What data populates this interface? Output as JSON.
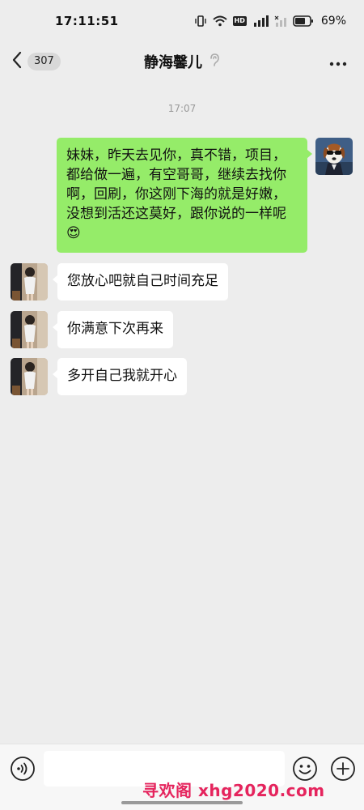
{
  "status_bar": {
    "time": "17:11:51",
    "battery_percent": "69%",
    "hd_label": "HD",
    "icons": [
      "vibrate-icon",
      "wifi-icon",
      "hd-icon",
      "signal-5g-icon",
      "signal-x-icon",
      "battery-icon"
    ]
  },
  "nav": {
    "unread_count": "307",
    "title": "静海馨儿",
    "icons": [
      "back-arrow-icon",
      "ear-icon",
      "more-dots-icon"
    ]
  },
  "chat": {
    "timestamp": "17:07",
    "messages": [
      {
        "direction": "outgoing",
        "avatar": "dog-avatar-icon",
        "text": "妹妹，昨天去见你，真不错，项目，都给做一遍，有空哥哥，继续去找你啊，回刷，你这刚下海的就是好嫩，没想到活还这莫好，跟你说的一样呢😍"
      },
      {
        "direction": "incoming",
        "avatar": "person-avatar-icon",
        "text": "您放心吧就自己时间充足"
      },
      {
        "direction": "incoming",
        "avatar": "person-avatar-icon",
        "text": "你满意下次再来"
      },
      {
        "direction": "incoming",
        "avatar": "person-avatar-icon",
        "text": "多开自己我就开心"
      }
    ]
  },
  "input_bar": {
    "value": "",
    "placeholder": "",
    "icons": [
      "voice-icon",
      "emoji-icon",
      "plus-icon"
    ]
  },
  "watermark": "寻欢阁 xhg2020.com",
  "colors": {
    "background": "#ededed",
    "outgoing_bubble": "#95ec69",
    "incoming_bubble": "#ffffff",
    "watermark": "#e5245d"
  }
}
